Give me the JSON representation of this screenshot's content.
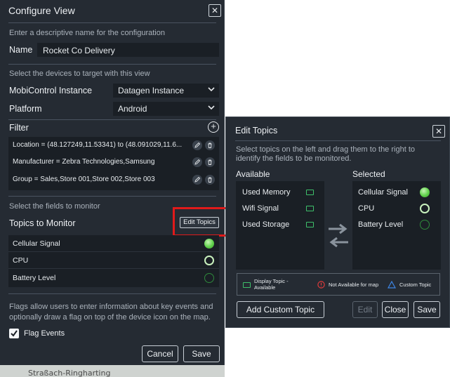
{
  "map": {
    "street_label": "Straßach-Ringharting"
  },
  "configure_view": {
    "title": "Configure View",
    "name_hint": "Enter a descriptive name for the configuration",
    "name_label": "Name",
    "name_value": "Rocket Co Delivery",
    "devices_hint": "Select the devices to target with this view",
    "instance_label": "MobiControl Instance",
    "instance_value": "Datagen Instance",
    "platform_label": "Platform",
    "platform_value": "Android",
    "filter_label": "Filter",
    "filters": [
      {
        "text": "Location = (48.127249,11.53341) to (48.091029,11.6..."
      },
      {
        "text": "Manufacturer = Zebra Technologies,Samsung"
      },
      {
        "text": "Group = Sales,Store 001,Store 002,Store 003"
      }
    ],
    "fields_hint": "Select the fields to monitor",
    "topics_label": "Topics to Monitor",
    "edit_topics_label": "Edit Topics",
    "topics": [
      {
        "name": "Cellular Signal",
        "status": "solid"
      },
      {
        "name": "CPU",
        "status": "ring"
      },
      {
        "name": "Battery Level",
        "status": "dark"
      }
    ],
    "flags_hint": "Flags allow users to enter information about key events and optionally draw a flag on top of the device icon on the map.",
    "flag_events_label": "Flag Events",
    "flag_events_checked": true,
    "cancel_label": "Cancel",
    "save_label": "Save"
  },
  "edit_topics": {
    "title": "Edit Topics",
    "hint": "Select topics on the left and drag them to the right to identify the fields to be monitored.",
    "available_label": "Available",
    "selected_label": "Selected",
    "available": [
      {
        "name": "Used Memory"
      },
      {
        "name": "Wifi Signal"
      },
      {
        "name": "Used Storage"
      }
    ],
    "selected": [
      {
        "name": "Cellular Signal",
        "status": "solid"
      },
      {
        "name": "CPU",
        "status": "ring"
      },
      {
        "name": "Battery Level",
        "status": "dark"
      }
    ],
    "legend": {
      "display_topic": "Display Topic - Available",
      "not_available": "Not Available for map",
      "custom_topic": "Custom Topic"
    },
    "add_custom_label": "Add Custom Topic",
    "edit_label": "Edit",
    "close_label": "Close",
    "save_label": "Save"
  },
  "colors": {
    "panel_bg": "#252b33",
    "field_bg": "#1a1f25",
    "accent_green": "#5fd14a",
    "highlight_red": "#e01a1a",
    "warning_red": "#e03a3a",
    "custom_blue": "#3d86e6"
  }
}
